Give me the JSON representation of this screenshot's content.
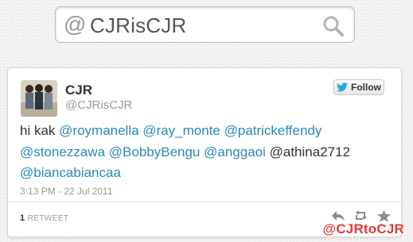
{
  "search": {
    "at_symbol": "@",
    "query": "CJRisCJR",
    "icon": "magnifier-icon"
  },
  "tweet": {
    "display_name": "CJR",
    "handle": "@CJRisCJR",
    "follow_label": "Follow",
    "follow_icon": "twitter-bird-icon",
    "mentions": [
      "@roymanella",
      "@ray_monte",
      "@patrickeffendy",
      "@stonezzawa",
      "@BobbyBengu",
      "@anggaoi",
      "@biancabiancaa"
    ],
    "prefix": "hi kak",
    "plain_mention": "@athina2712",
    "timestamp": "3:13 PM - 22 Jul 2011",
    "retweet_count": "1",
    "retweet_label": "RETWEET",
    "actions": [
      "reply-icon",
      "retweet-icon",
      "favorite-icon"
    ]
  },
  "watermark": "@CJRtoCJR",
  "colors": {
    "link": "#2a8ab8",
    "follow_bird": "#2aa9e0",
    "watermark": "#e33a3a"
  }
}
